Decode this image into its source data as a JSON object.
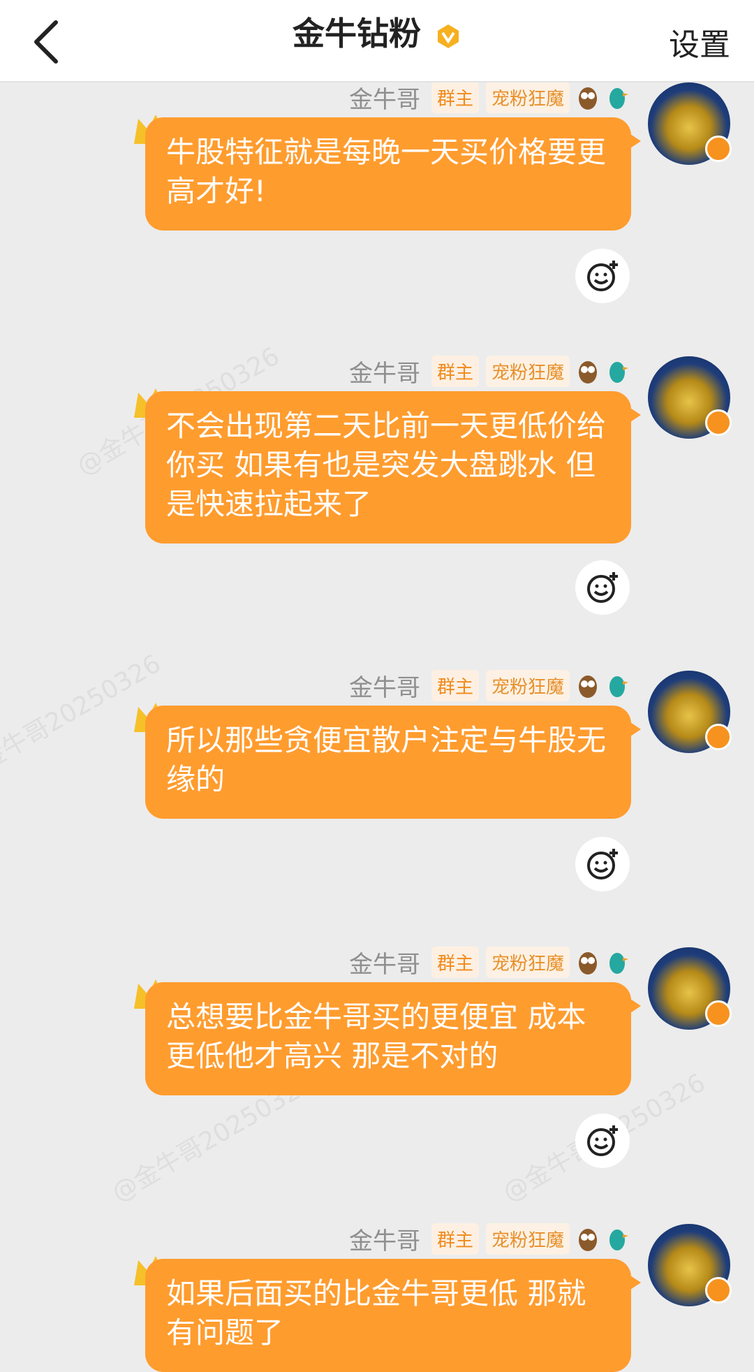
{
  "header": {
    "title": "金牛钻粉",
    "settings_label": "设置",
    "back_icon": "chevron-left-icon",
    "vip_icon": "gold-v-badge-icon"
  },
  "colors": {
    "bubble": "#ff9c2e",
    "badge_text": "#f08a1a",
    "background": "#ececec"
  },
  "watermark_text": "@金牛哥20250326",
  "messages": [
    {
      "sender": "金牛哥",
      "badge_owner": "群主",
      "badge_fan": "宠粉狂魔",
      "text": "牛股特征就是每晚一天买价格要更高才好!"
    },
    {
      "sender": "金牛哥",
      "badge_owner": "群主",
      "badge_fan": "宠粉狂魔",
      "text": "不会出现第二天比前一天更低价给你买 如果有也是突发大盘跳水 但是快速拉起来了"
    },
    {
      "sender": "金牛哥",
      "badge_owner": "群主",
      "badge_fan": "宠粉狂魔",
      "text": "所以那些贪便宜散户注定与牛股无缘的"
    },
    {
      "sender": "金牛哥",
      "badge_owner": "群主",
      "badge_fan": "宠粉狂魔",
      "text": "总想要比金牛哥买的更便宜 成本更低他才高兴 那是不对的"
    },
    {
      "sender": "金牛哥",
      "badge_owner": "群主",
      "badge_fan": "宠粉狂魔",
      "text": "如果后面买的比金牛哥更低 那就有问题了"
    }
  ]
}
